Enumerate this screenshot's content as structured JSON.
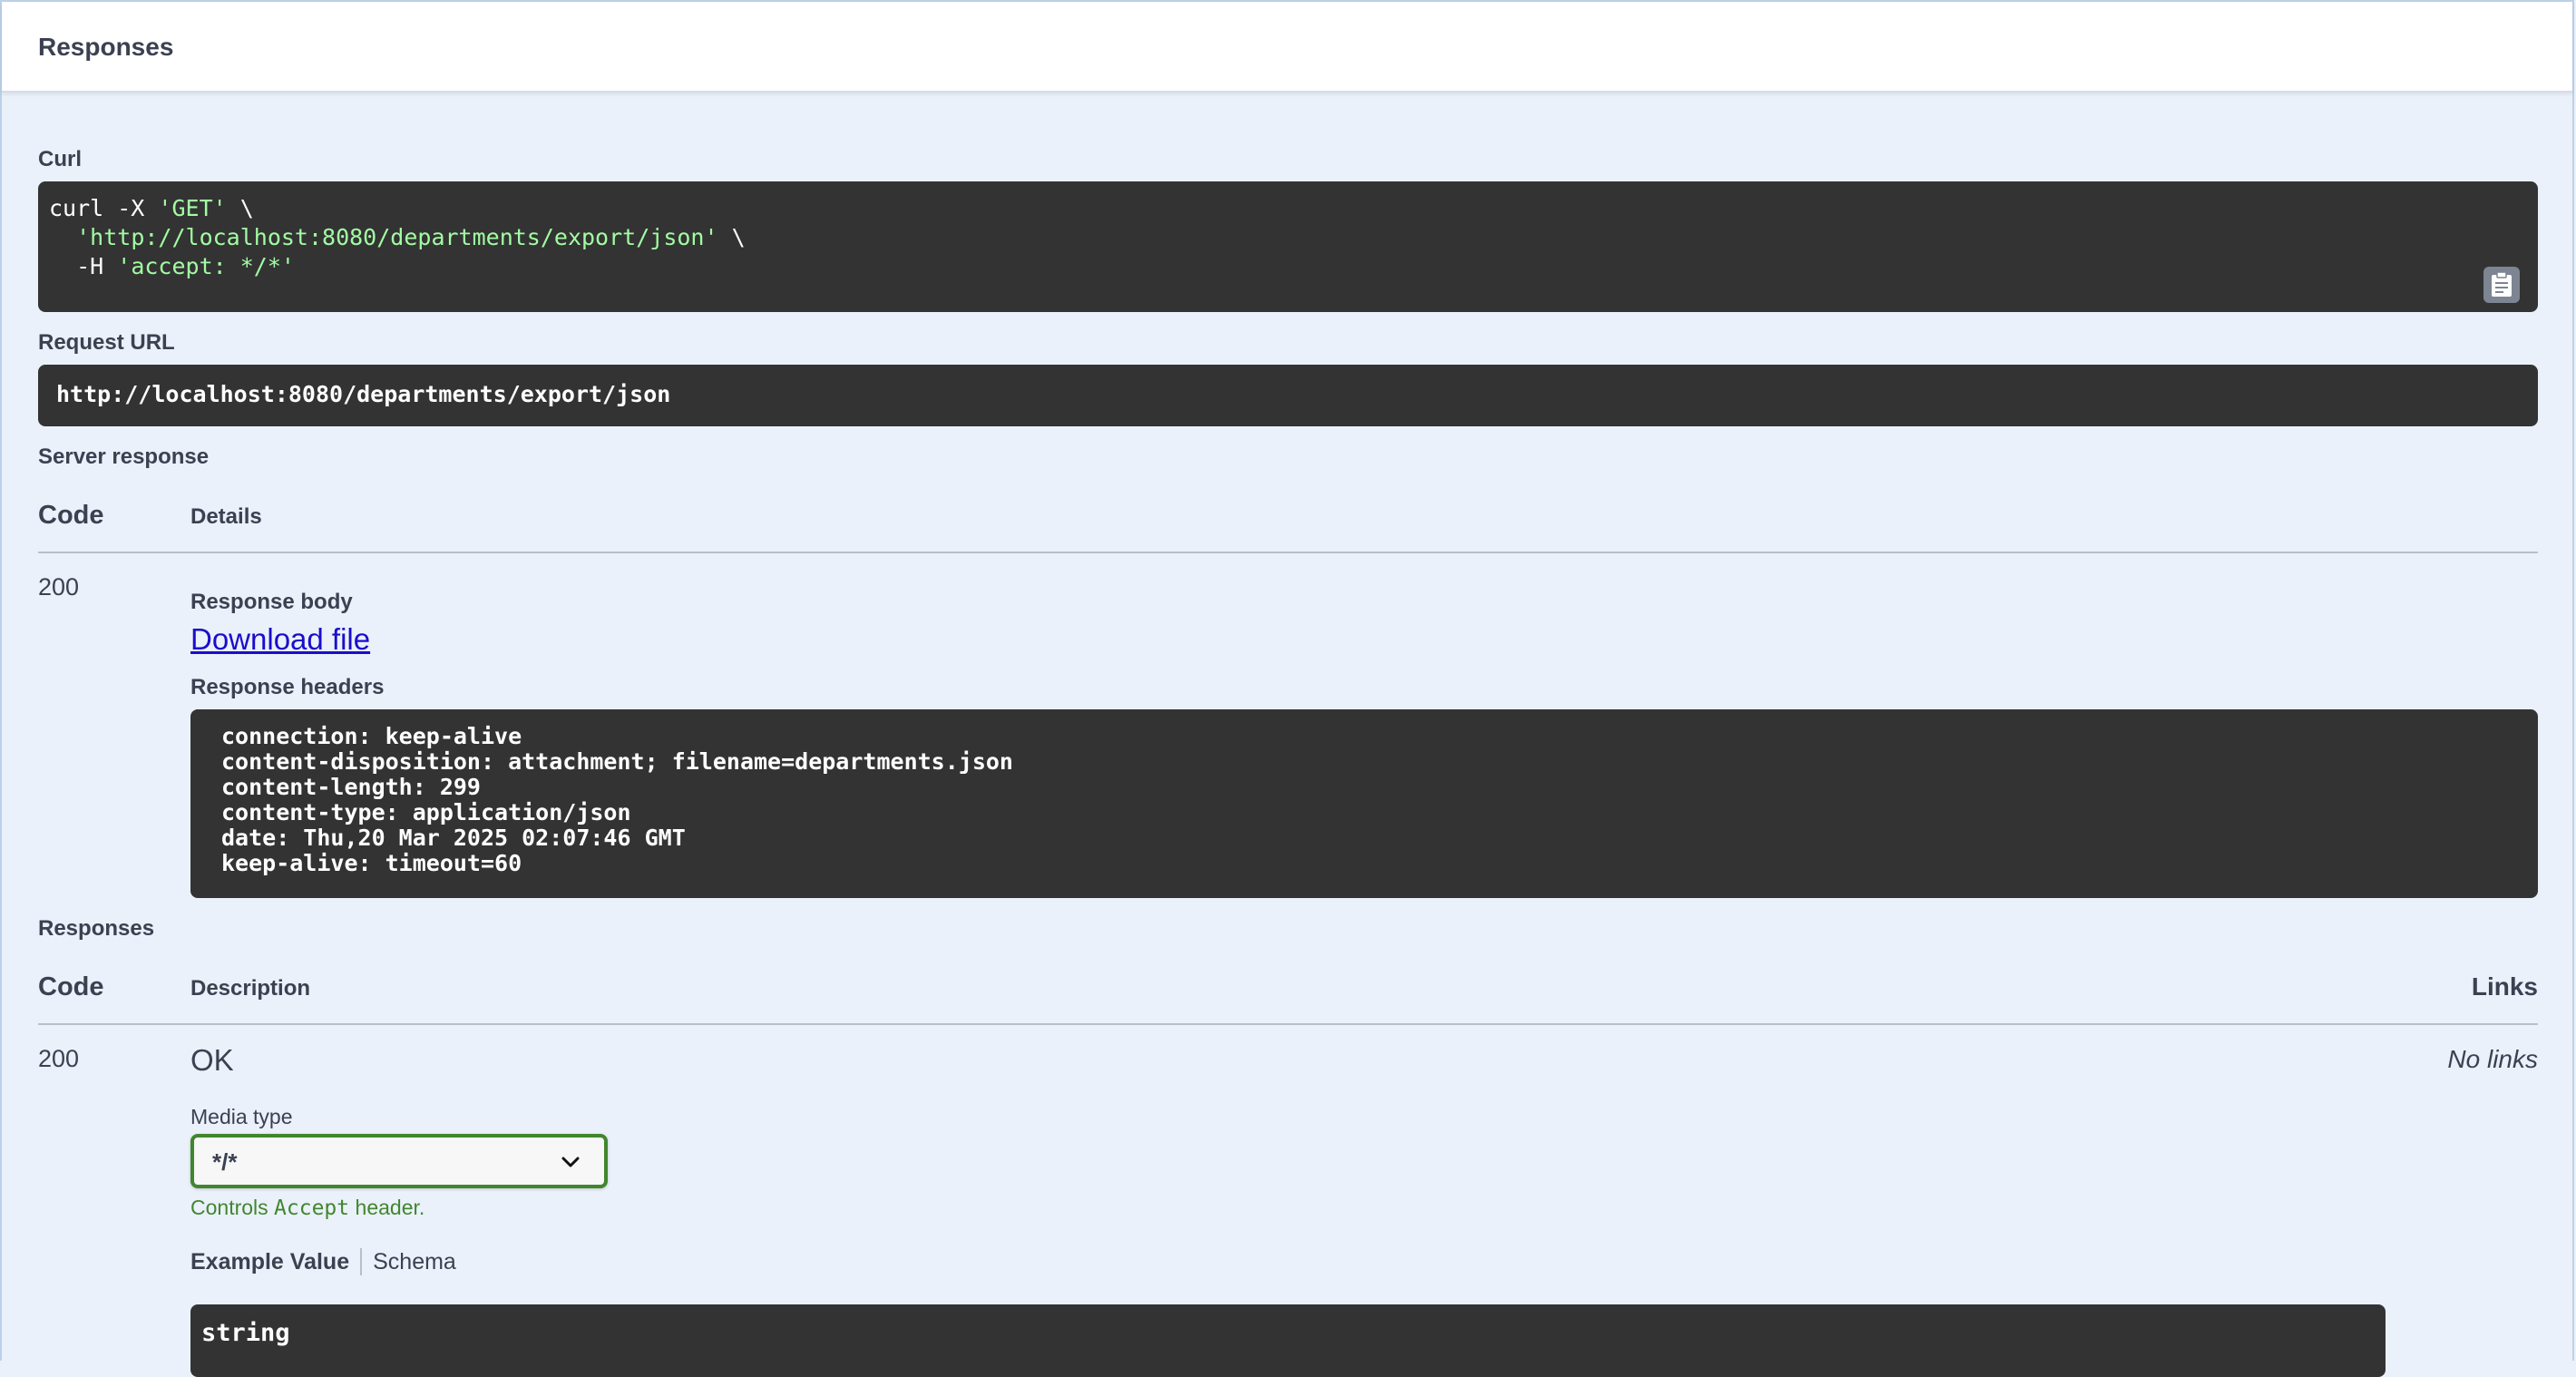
{
  "header": {
    "title": "Responses"
  },
  "curl": {
    "label": "Curl",
    "cmd_prefix": "curl -X ",
    "method": "'GET'",
    "line1_end": " \\",
    "indent": "  ",
    "url": "'http://localhost:8080/departments/export/json'",
    "line2_end": " \\",
    "header_flag": "-H ",
    "header_value": "'accept: */*'",
    "copy_icon": "clipboard-icon"
  },
  "request_url": {
    "label": "Request URL",
    "value": "http://localhost:8080/departments/export/json"
  },
  "server_response": {
    "label": "Server response",
    "col_code": "Code",
    "col_details": "Details",
    "code": "200",
    "body_label": "Response body",
    "download_link": "Download file",
    "headers_label": "Response headers",
    "headers": [
      "connection: keep-alive",
      "content-disposition: attachment; filename=departments.json",
      "content-length: 299",
      "content-type: application/json",
      "date: Thu,20 Mar 2025 02:07:46 GMT",
      "keep-alive: timeout=60"
    ]
  },
  "responses": {
    "label": "Responses",
    "col_code": "Code",
    "col_description": "Description",
    "col_links": "Links",
    "code": "200",
    "description": "OK",
    "links": "No links",
    "media_type_label": "Media type",
    "media_type_value": "*/*",
    "hint_prefix": "Controls ",
    "hint_code": "Accept",
    "hint_suffix": " header.",
    "tab_example": "Example Value",
    "tab_schema": "Schema",
    "example_value": "string"
  },
  "colors": {
    "background": "#eaf1fa",
    "code_bg": "#333333",
    "string_green": "#a2fca2",
    "select_border": "#41862e",
    "link_blue": "#1a0dcc"
  }
}
